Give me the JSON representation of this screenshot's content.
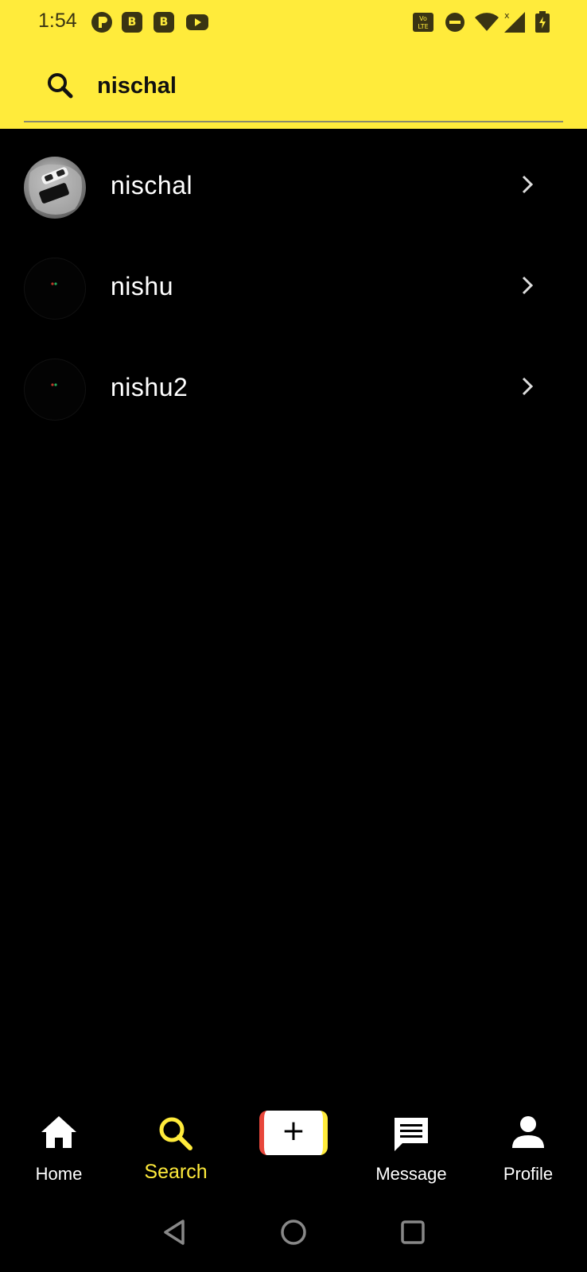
{
  "status_bar": {
    "time": "1:54",
    "notification_icons": [
      "p-circle-icon",
      "b-badge-icon",
      "b-badge-icon",
      "youtube-icon"
    ],
    "badge_letter": "B",
    "volte_label": "Vo LTE",
    "right_icons": [
      "volte-icon",
      "do-not-disturb-icon",
      "wifi-icon",
      "signal-icon",
      "battery-charging-icon"
    ]
  },
  "search": {
    "value": "nischal",
    "placeholder": ""
  },
  "results": [
    {
      "name": "nischal",
      "avatar": "photo"
    },
    {
      "name": "nishu",
      "avatar": "dark"
    },
    {
      "name": "nishu2",
      "avatar": "dark"
    }
  ],
  "bottom_nav": {
    "home_label": "Home",
    "search_label": "Search",
    "add_label": "+",
    "message_label": "Message",
    "profile_label": "Profile"
  },
  "colors": {
    "accent": "#FFEB3B",
    "background": "#000000",
    "add_left": "#e8473b",
    "text": "#FFFFFF"
  }
}
